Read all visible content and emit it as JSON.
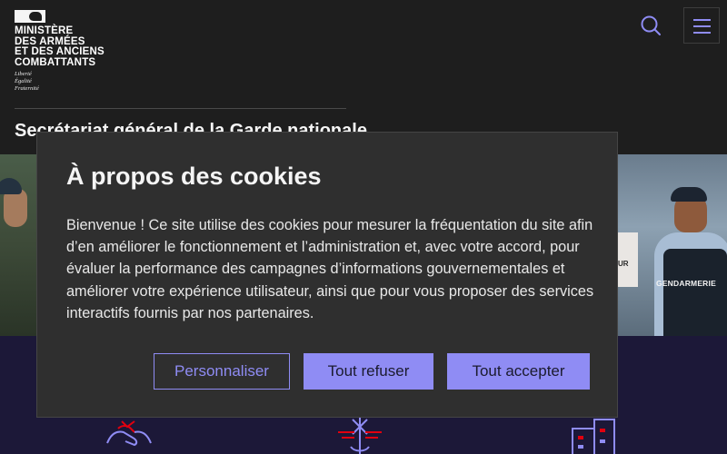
{
  "header": {
    "logo": {
      "name_lines": [
        "MINISTÈRE",
        "DES ARMÉES",
        "ET DES ANCIENS",
        "COMBATTANTS"
      ],
      "motto_lines": [
        "Liberté",
        "Égalité",
        "Fraternité"
      ]
    },
    "site_title": "Secrétariat général de la Garde nationale",
    "search_icon": "search-icon",
    "menu_icon": "hamburger-menu-icon",
    "accent_color": "#8f8cf4"
  },
  "hero": {
    "left_image": "soldier-photo",
    "right_image": "gendarme-photo",
    "right_wall_text": "UR",
    "right_vest_label": "GENDARMERIE"
  },
  "cookie_modal": {
    "title": "À propos des cookies",
    "text": "Bienvenue ! Ce site utilise des cookies pour mesurer la fréquentation du site afin d’en améliorer le fonctionnement et l’administration et, avec votre accord, pour évaluer la performance des campagnes d’informations gouvernementales et améliorer votre expérience utilisateur, ainsi que pour vous proposer des services interactifs fournis par nos partenaires.",
    "buttons": {
      "customize": "Personnaliser",
      "refuse_all": "Tout refuser",
      "accept_all": "Tout accepter"
    }
  },
  "pictograms": [
    "handshake-icon",
    "anchor-wings-icon",
    "city-buildings-icon"
  ]
}
